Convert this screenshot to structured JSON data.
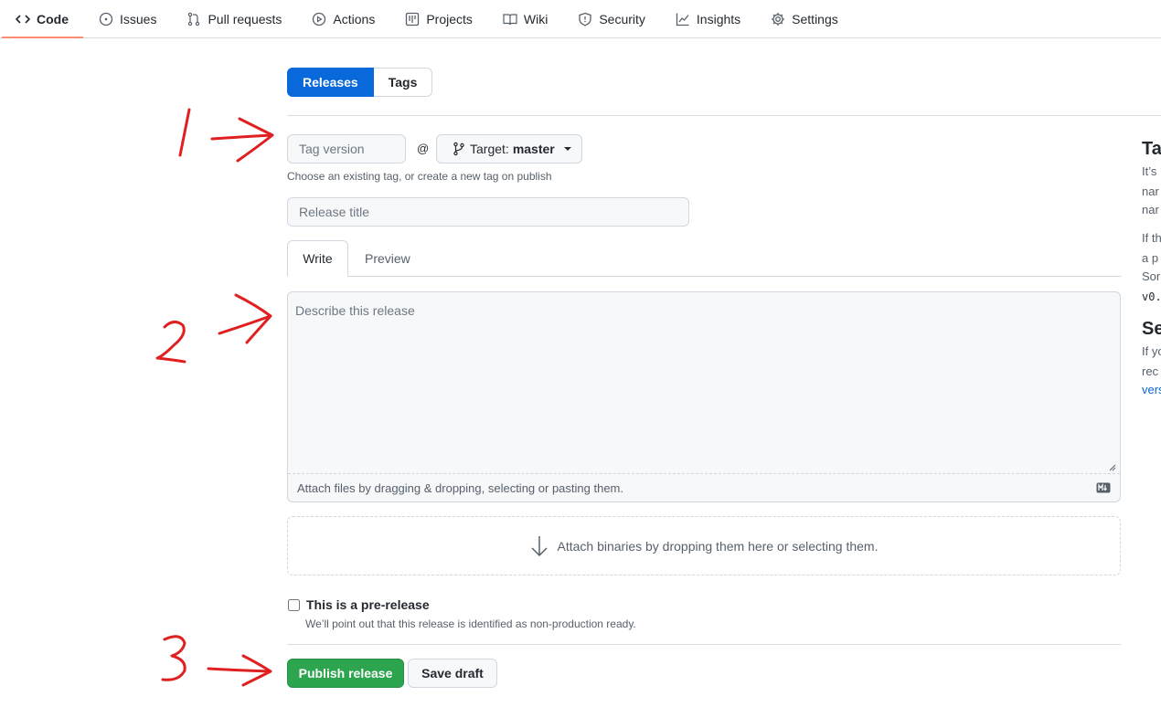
{
  "nav": {
    "tabs": [
      {
        "label": "Code",
        "icon": "code-icon",
        "selected": true
      },
      {
        "label": "Issues",
        "icon": "issue-icon"
      },
      {
        "label": "Pull requests",
        "icon": "pull-request-icon"
      },
      {
        "label": "Actions",
        "icon": "play-icon"
      },
      {
        "label": "Projects",
        "icon": "project-icon"
      },
      {
        "label": "Wiki",
        "icon": "book-icon"
      },
      {
        "label": "Security",
        "icon": "shield-icon"
      },
      {
        "label": "Insights",
        "icon": "graph-icon"
      },
      {
        "label": "Settings",
        "icon": "gear-icon"
      }
    ]
  },
  "subnav": {
    "releases": "Releases",
    "tags": "Tags"
  },
  "form": {
    "tag_placeholder": "Tag version",
    "at": "@",
    "target_label": "Target:",
    "target_value": "master",
    "tag_hint": "Choose an existing tag, or create a new tag on publish",
    "title_placeholder": "Release title",
    "tab_write": "Write",
    "tab_preview": "Preview",
    "body_placeholder": "Describe this release",
    "attach_files": "Attach files by dragging & dropping, selecting or pasting them.",
    "attach_binaries": "Attach binaries by dropping them here or selecting them.",
    "prerelease_label": "This is a pre-release",
    "prerelease_note": "We’ll point out that this release is identified as non-production ready.",
    "publish": "Publish release",
    "save_draft": "Save draft"
  },
  "sidebar": {
    "heading1": "Ta",
    "lines1": [
      "It’s",
      "nar",
      "nar"
    ],
    "lines2": [
      "If th",
      "a p",
      "Sor"
    ],
    "code_frag": "v0.",
    "heading2": "Se",
    "lines3": [
      "If yo",
      "rec"
    ],
    "link": "vers"
  },
  "annotations": {
    "one": "1",
    "two": "2",
    "three": "3",
    "color": "#e02020"
  },
  "colors": {
    "primary_blue": "#0969da",
    "publish_green": "#2da44e",
    "tab_underline": "#fd8c73"
  }
}
